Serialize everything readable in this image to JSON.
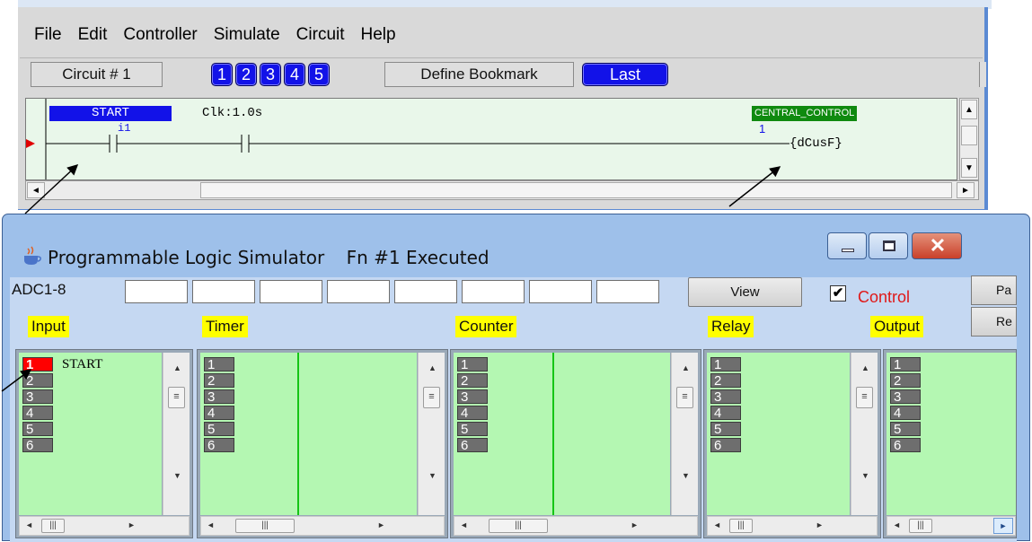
{
  "editor": {
    "menu": [
      "File",
      "Edit",
      "Controller",
      "Simulate",
      "Circuit",
      "Help"
    ],
    "circuit_label": "Circuit # 1",
    "bookmarks": [
      "1",
      "2",
      "3",
      "4",
      "5"
    ],
    "define_bookmark_label": "Define Bookmark",
    "last_label": "Last",
    "rung": {
      "input_label": "START",
      "input_tag": "i1",
      "timer_label": "Clk:1.0s",
      "output_label": "CENTRAL_CONTROL",
      "output_number": "1",
      "output_coil": "{dCusF}"
    }
  },
  "simulator": {
    "title": "Programmable Logic Simulator",
    "status": "Fn #1 Executed",
    "adc_label": "ADC1-8",
    "adc_values": [
      "",
      "",
      "",
      "",
      "",
      "",
      "",
      ""
    ],
    "view_label": "View",
    "control_checked": "✔",
    "control_label": "Control",
    "side_buttons": [
      "Pa",
      "Re"
    ],
    "sections": [
      "Input",
      "Timer",
      "Counter",
      "Relay",
      "Output"
    ],
    "slot_numbers": [
      "1",
      "2",
      "3",
      "4",
      "5",
      "6"
    ],
    "input_first_name": "START"
  },
  "colors": {
    "bookmark_blue": "#1212e8",
    "label_yellow": "#ffff00",
    "panel_green": "#b4f7b2",
    "active_input_red": "#ff0000",
    "control_red": "#e01818"
  }
}
